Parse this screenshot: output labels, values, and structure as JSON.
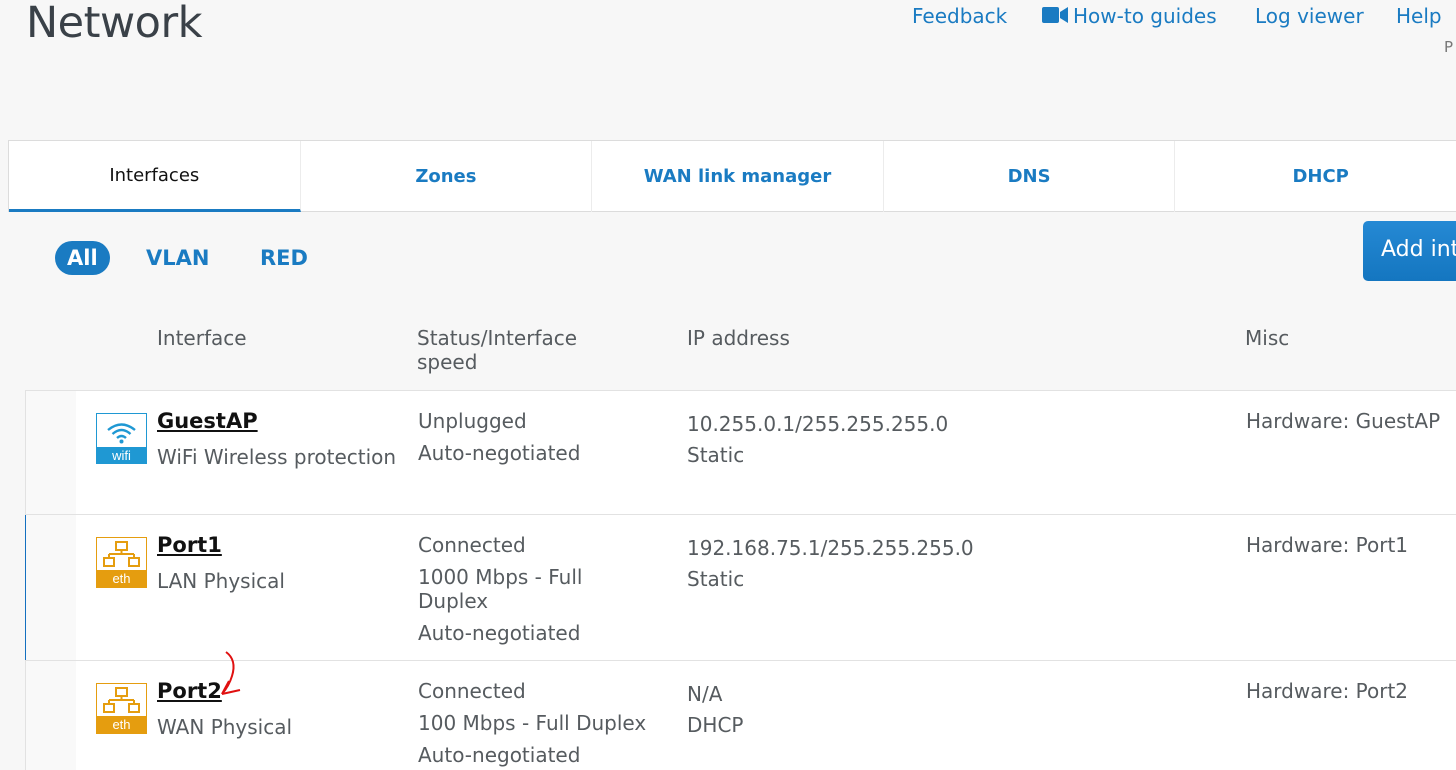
{
  "page": {
    "title": "Network"
  },
  "top_links": {
    "feedback": "Feedback",
    "howto": "How-to guides",
    "logviewer": "Log viewer",
    "help": "Help",
    "clipped": "P"
  },
  "tabs": [
    {
      "label": "Interfaces",
      "active": true
    },
    {
      "label": "Zones"
    },
    {
      "label": "WAN link manager"
    },
    {
      "label": "DNS"
    },
    {
      "label": "DHCP"
    }
  ],
  "filters": {
    "all": "All",
    "vlan": "VLAN",
    "red": "RED"
  },
  "add_button": "Add int",
  "columns": {
    "interface": "Interface",
    "status": "Status/Interface speed",
    "ip": "IP address",
    "misc": "Misc"
  },
  "rows": [
    {
      "icon": "wifi-icon",
      "icon_label": "wifi",
      "name": "GuestAP",
      "sub1": "WiFi",
      "sub2": "Wireless protection",
      "status1": "Unplugged",
      "status2": "Auto-negotiated",
      "ip1": "10.255.0.1/255.255.255.0",
      "ip2": "Static",
      "misc": "Hardware:  GuestAP"
    },
    {
      "icon": "eth-icon",
      "icon_label": "eth",
      "name": "Port1",
      "sub1": "LAN",
      "sub2": "Physical",
      "status1": "Connected",
      "status2": "1000 Mbps - Full Duplex",
      "status3": "Auto-negotiated",
      "ip1": "192.168.75.1/255.255.255.0",
      "ip2": "Static",
      "misc": "Hardware:  Port1"
    },
    {
      "icon": "eth-icon",
      "icon_label": "eth",
      "name": "Port2",
      "sub1": "WAN",
      "sub2": "Physical",
      "status1": "Connected",
      "status2": "100 Mbps - Full Duplex",
      "status3": "Auto-negotiated",
      "ip1": "N/A",
      "ip2": "DHCP",
      "misc": "Hardware:  Port2"
    }
  ],
  "colors": {
    "accent": "#1a7bc2",
    "selected_bar": "#1470c0",
    "wifi_icon": "#1f98d3",
    "eth_icon": "#e59d0f",
    "annotation": "#e01010"
  }
}
